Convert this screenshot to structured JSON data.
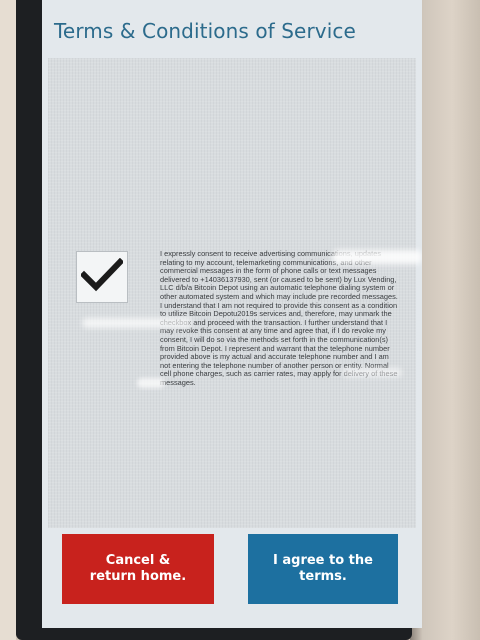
{
  "screen": {
    "title": "Terms & Conditions of Service"
  },
  "consent": {
    "checked": true,
    "checkbox_icon": "checkmark-icon",
    "text": "I expressly consent to receive advertising communications, updates relating to my account, telemarketing communications, and other commercial messages in the form of phone calls or text messages delivered to +14036137930, sent (or caused to be sent) by Lux Vending, LLC d/b/a Bitcoin Depot using an automatic telephone dialing system or other automated system and which may include pre recorded messages. I understand that I am not required to provide this consent as a condition to utilize Bitcoin Depotu2019s services and, therefore, may unmark the checkbox and proceed with the transaction. I further understand that I may revoke this consent at any time and agree that, if I do revoke my consent, I will do so via the methods set forth in the communication(s) from Bitcoin Depot. I represent and warrant that the telephone number provided above is my actual and accurate telephone number and I am not entering the telephone number of another person or entity. Normal cell phone charges, such as carrier rates, may apply for delivery of these messages."
  },
  "buttons": {
    "cancel_label": "Cancel &\nreturn home.",
    "agree_label": "I agree to the\nterms."
  },
  "colors": {
    "title": "#2c6b8c",
    "cancel": "#c8221d",
    "agree": "#1d70a0"
  }
}
